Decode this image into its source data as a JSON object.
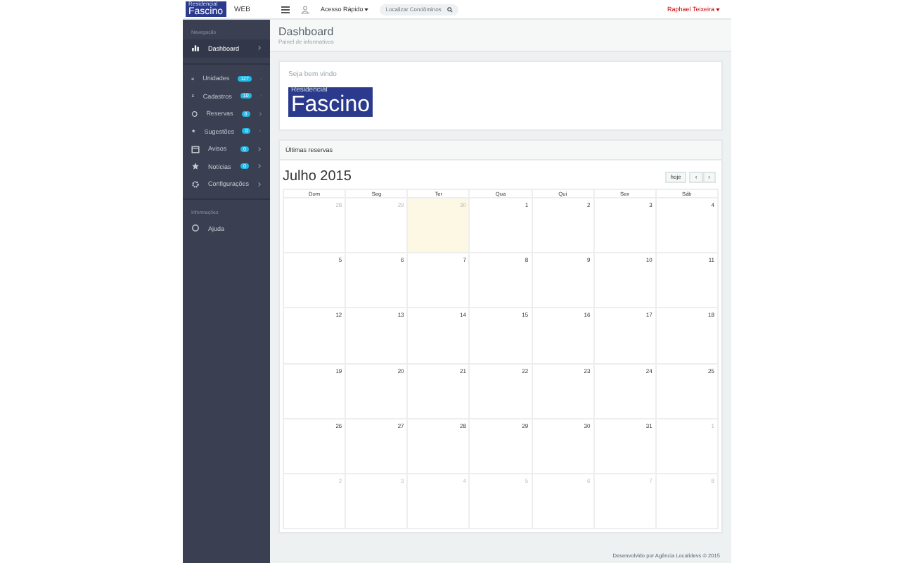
{
  "topbar": {
    "logo_small": "Residencial",
    "logo": "Fascino",
    "logo_tag": "WEB",
    "quick_access": "Acesso Rápido",
    "search": {
      "placeholder": "Localizar Condôminos"
    },
    "user": "Raphael Teixeira"
  },
  "sidebar": {
    "sections": [
      {
        "heading": "Navegação",
        "items": [
          {
            "label": "Dashboard",
            "selected": true
          },
          {
            "label": "Unidades",
            "badge": "127",
            "selected": false
          },
          {
            "label": "Cadastros",
            "badge": "10",
            "selected": false
          },
          {
            "label": "Reservas",
            "badge": "0",
            "selected": false
          },
          {
            "label": "Sugestões",
            "badge": "0",
            "selected": false
          },
          {
            "label": "Avisos",
            "badge": "0",
            "selected": false
          },
          {
            "label": "Notícias",
            "badge": "0",
            "selected": false
          },
          {
            "label": "Configurações",
            "selected": false
          }
        ]
      },
      {
        "heading": "Informações",
        "items": [
          {
            "label": "Ajuda",
            "selected": false
          }
        ]
      }
    ]
  },
  "page": {
    "title": "Dashboard",
    "subtitle": "Painel de informativos"
  },
  "welcome": {
    "text": "Seja bem vindo",
    "logo_small": "Residencial",
    "logo": "Fascino"
  },
  "calendar_panel": {
    "heading": "Últimas reservas",
    "title": "Julho 2015",
    "today_button": "hoje",
    "prev": "‹",
    "next": "›",
    "weekdays": [
      "Dom",
      "Seg",
      "Ter",
      "Qua",
      "Qui",
      "Sex",
      "Sáb"
    ],
    "weeks": [
      [
        {
          "day": "28",
          "other": true,
          "today": false
        },
        {
          "day": "29",
          "other": true,
          "today": false
        },
        {
          "day": "30",
          "other": true,
          "today": true
        },
        {
          "day": "1",
          "other": false,
          "today": false
        },
        {
          "day": "2",
          "other": false,
          "today": false
        },
        {
          "day": "3",
          "other": false,
          "today": false
        },
        {
          "day": "4",
          "other": false,
          "today": false
        }
      ],
      [
        {
          "day": "5",
          "other": false,
          "today": false
        },
        {
          "day": "6",
          "other": false,
          "today": false
        },
        {
          "day": "7",
          "other": false,
          "today": false
        },
        {
          "day": "8",
          "other": false,
          "today": false
        },
        {
          "day": "9",
          "other": false,
          "today": false
        },
        {
          "day": "10",
          "other": false,
          "today": false
        },
        {
          "day": "11",
          "other": false,
          "today": false
        }
      ],
      [
        {
          "day": "12",
          "other": false,
          "today": false
        },
        {
          "day": "13",
          "other": false,
          "today": false
        },
        {
          "day": "14",
          "other": false,
          "today": false
        },
        {
          "day": "15",
          "other": false,
          "today": false
        },
        {
          "day": "16",
          "other": false,
          "today": false
        },
        {
          "day": "17",
          "other": false,
          "today": false
        },
        {
          "day": "18",
          "other": false,
          "today": false
        }
      ],
      [
        {
          "day": "19",
          "other": false,
          "today": false
        },
        {
          "day": "20",
          "other": false,
          "today": false
        },
        {
          "day": "21",
          "other": false,
          "today": false
        },
        {
          "day": "22",
          "other": false,
          "today": false
        },
        {
          "day": "23",
          "other": false,
          "today": false
        },
        {
          "day": "24",
          "other": false,
          "today": false
        },
        {
          "day": "25",
          "other": false,
          "today": false
        }
      ],
      [
        {
          "day": "26",
          "other": false,
          "today": false
        },
        {
          "day": "27",
          "other": false,
          "today": false
        },
        {
          "day": "28",
          "other": false,
          "today": false
        },
        {
          "day": "29",
          "other": false,
          "today": false
        },
        {
          "day": "30",
          "other": false,
          "today": false
        },
        {
          "day": "31",
          "other": false,
          "today": false
        },
        {
          "day": "1",
          "other": true,
          "today": false
        }
      ],
      [
        {
          "day": "2",
          "other": true,
          "today": false
        },
        {
          "day": "3",
          "other": true,
          "today": false
        },
        {
          "day": "4",
          "other": true,
          "today": false
        },
        {
          "day": "5",
          "other": true,
          "today": false
        },
        {
          "day": "6",
          "other": true,
          "today": false
        },
        {
          "day": "7",
          "other": true,
          "today": false
        },
        {
          "day": "8",
          "other": true,
          "today": false
        }
      ]
    ]
  },
  "footer": "Desenvolvido por Agência Localidevs © 2015"
}
